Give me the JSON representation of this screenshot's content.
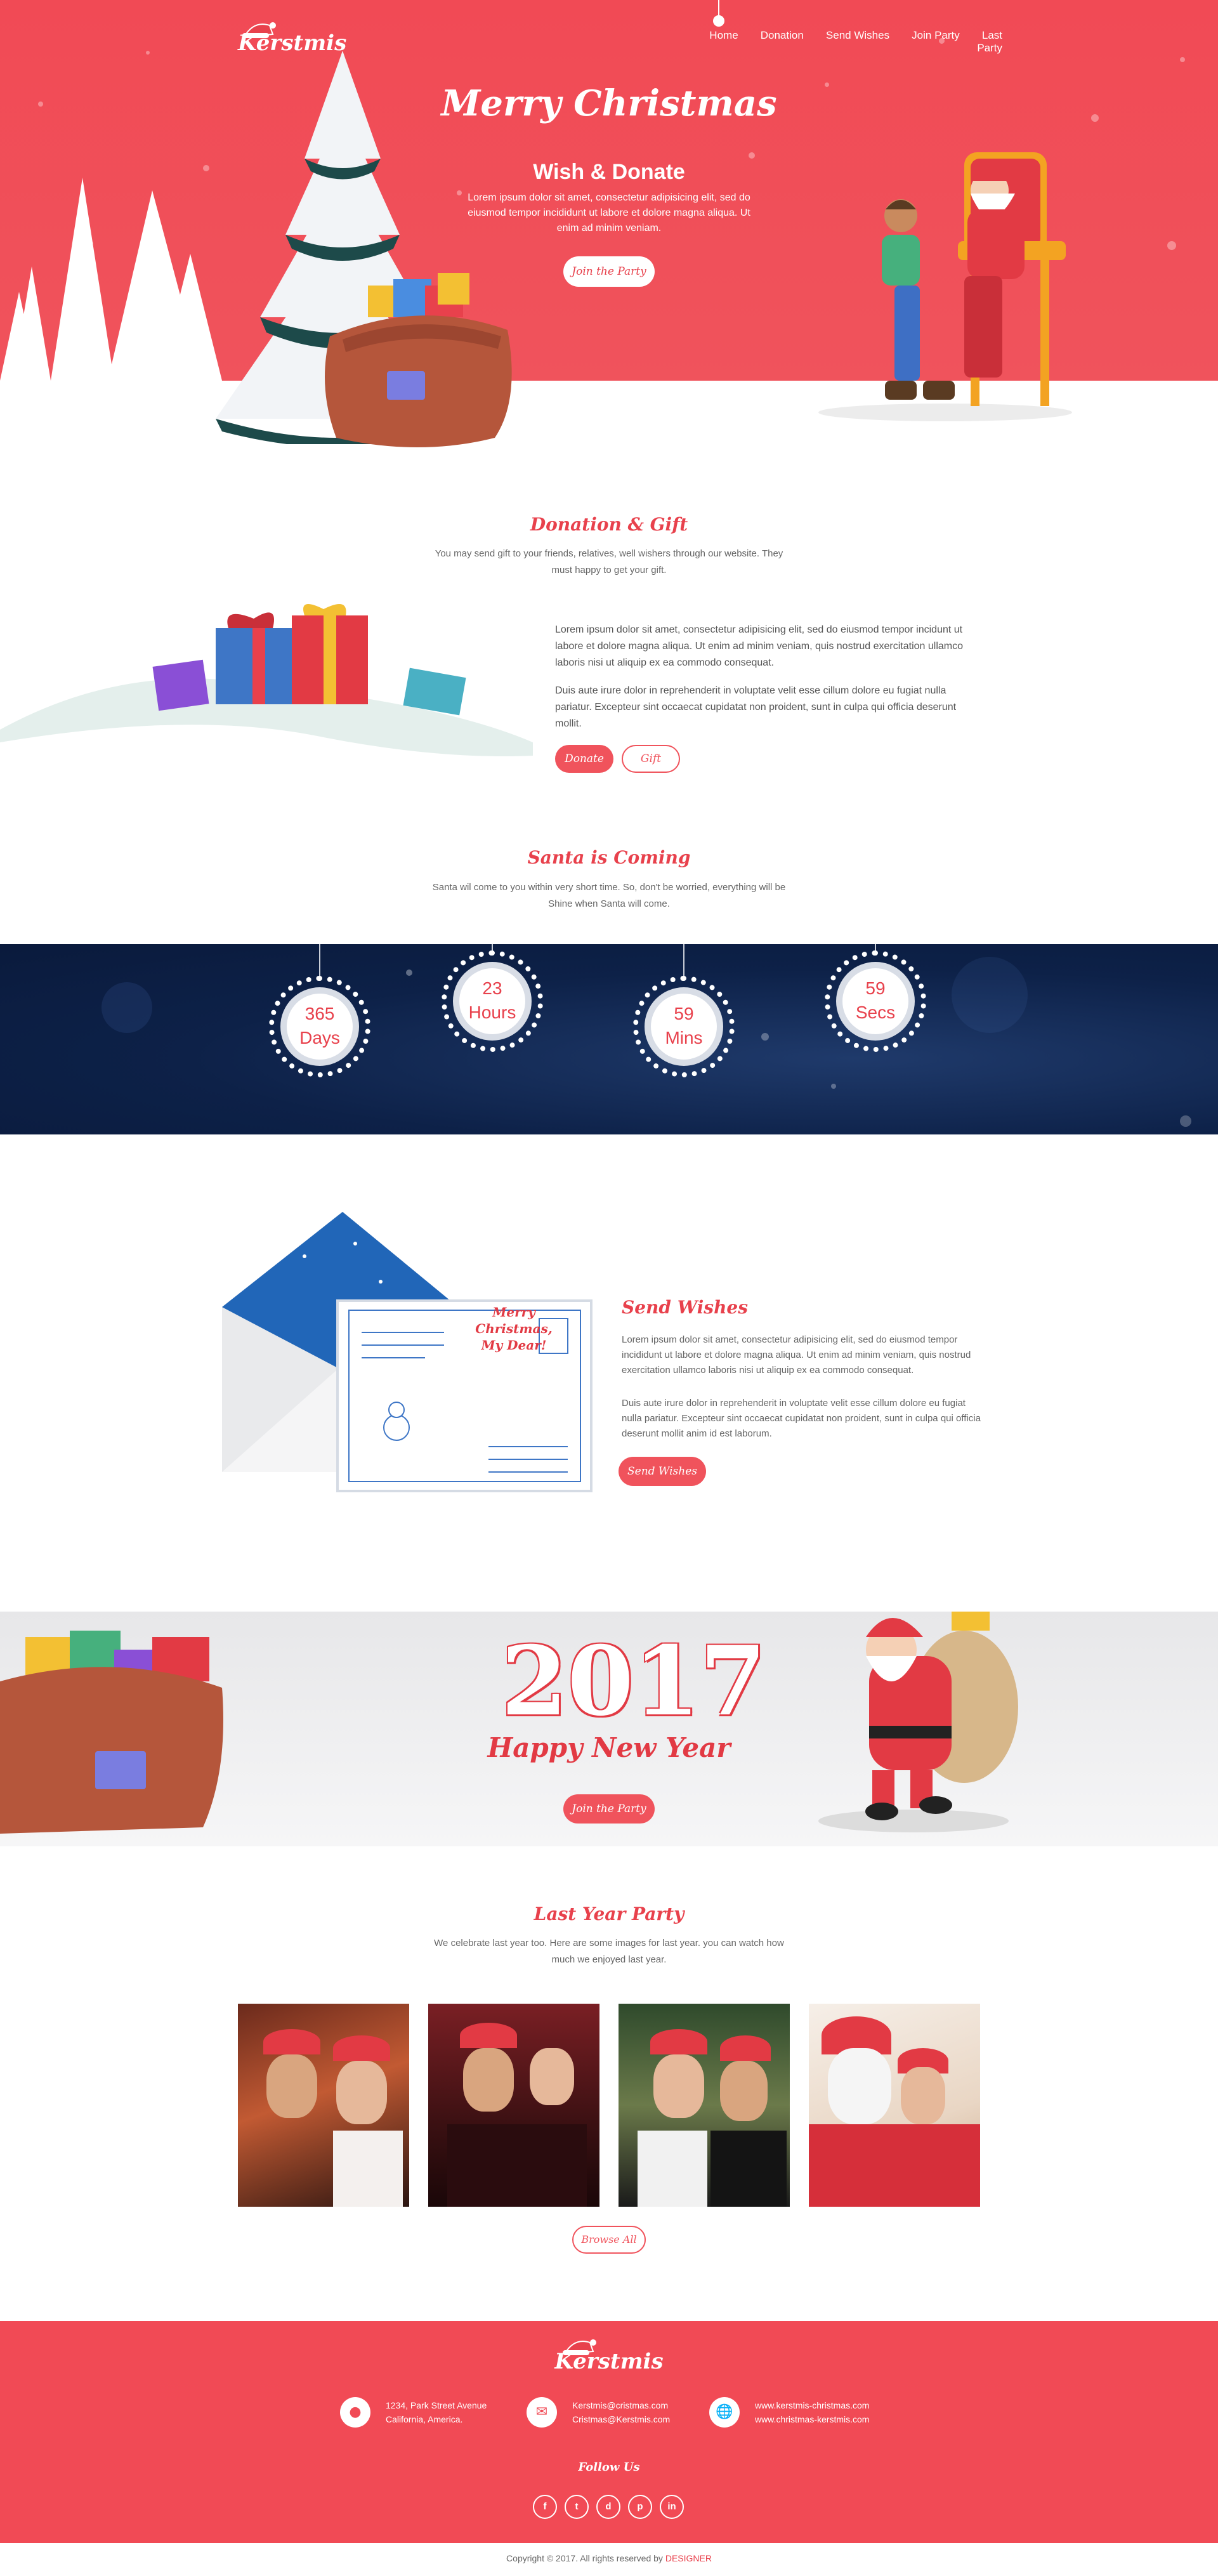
{
  "brand": {
    "name": "Kerstmis"
  },
  "nav": {
    "items": [
      "Home",
      "Donation",
      "Send Wishes",
      "Join Party",
      "Last Party"
    ]
  },
  "hero": {
    "title": "Merry Christmas",
    "subtitle": "Wish & Donate",
    "text": "Lorem ipsum dolor sit amet, consectetur adipisicing elit, sed do eiusmod tempor incididunt ut labore et dolore magna aliqua. Ut enim ad minim veniam.",
    "cta": "Join the Party"
  },
  "donation": {
    "title": "Donation & Gift",
    "intro": "You may send gift to your friends, relatives, well wishers through our website. They must happy to get your gift.",
    "p1": "Lorem ipsum dolor sit amet, consectetur adipisicing elit, sed do eiusmod tempor incidunt ut labore et dolore magna aliqua. Ut enim ad minim veniam, quis nostrud exercitation ullamco laboris nisi ut aliquip ex ea commodo consequat.",
    "p2": "Duis aute irure dolor in reprehenderit in voluptate velit esse cillum dolore eu fugiat nulla pariatur. Excepteur sint occaecat cupidatat non proident, sunt in culpa qui officia deserunt mollit.",
    "btn_donate": "Donate",
    "btn_gift": "Gift"
  },
  "santa": {
    "title": "Santa is Coming",
    "intro": "Santa wil come to you within very short time. So, don't be worried, everything will be Shine when Santa will come."
  },
  "countdown": [
    {
      "value": "365",
      "unit": "Days"
    },
    {
      "value": "23",
      "unit": "Hours"
    },
    {
      "value": "59",
      "unit": "Mins"
    },
    {
      "value": "59",
      "unit": "Secs"
    }
  ],
  "wishes": {
    "title": "Send Wishes",
    "card_text": "Merry Christmas, My Dear!",
    "p1": "Lorem ipsum dolor sit amet, consectetur adipisicing elit, sed do eiusmod tempor incididunt ut labore et dolore magna aliqua. Ut enim ad minim veniam, quis nostrud exercitation ullamco laboris nisi ut aliquip ex ea commodo consequat.",
    "p2": "Duis aute irure dolor in reprehenderit in voluptate velit esse cillum dolore eu fugiat nulla pariatur. Excepteur sint occaecat cupidatat non proident, sunt in culpa qui officia deserunt mollit anim id est laborum.",
    "cta": "Send Wishes"
  },
  "newyear": {
    "year": "2017",
    "tagline": "Happy New Year",
    "cta": "Join the Party"
  },
  "party": {
    "title": "Last Year Party",
    "intro": "We celebrate last year too. Here are some images for last year. you can watch how much we enjoyed last year.",
    "cta": "Browse All"
  },
  "footer": {
    "brand": "Kerstmis",
    "address": [
      "1234, Park Street Avenue",
      "California, America."
    ],
    "emails": [
      "Kerstmis@cristmas.com",
      "Cristmas@Kerstmis.com"
    ],
    "websites": [
      "www.kerstmis-christmas.com",
      "www.christmas-kerstmis.com"
    ],
    "follow": "Follow Us",
    "social": [
      "f",
      "t",
      "d",
      "p",
      "in"
    ],
    "copyright": "Copyright © 2017. All rights reserved by",
    "designer": "DESIGNER"
  },
  "colors": {
    "accent": "#f14a55",
    "navy": "#0d2148"
  }
}
